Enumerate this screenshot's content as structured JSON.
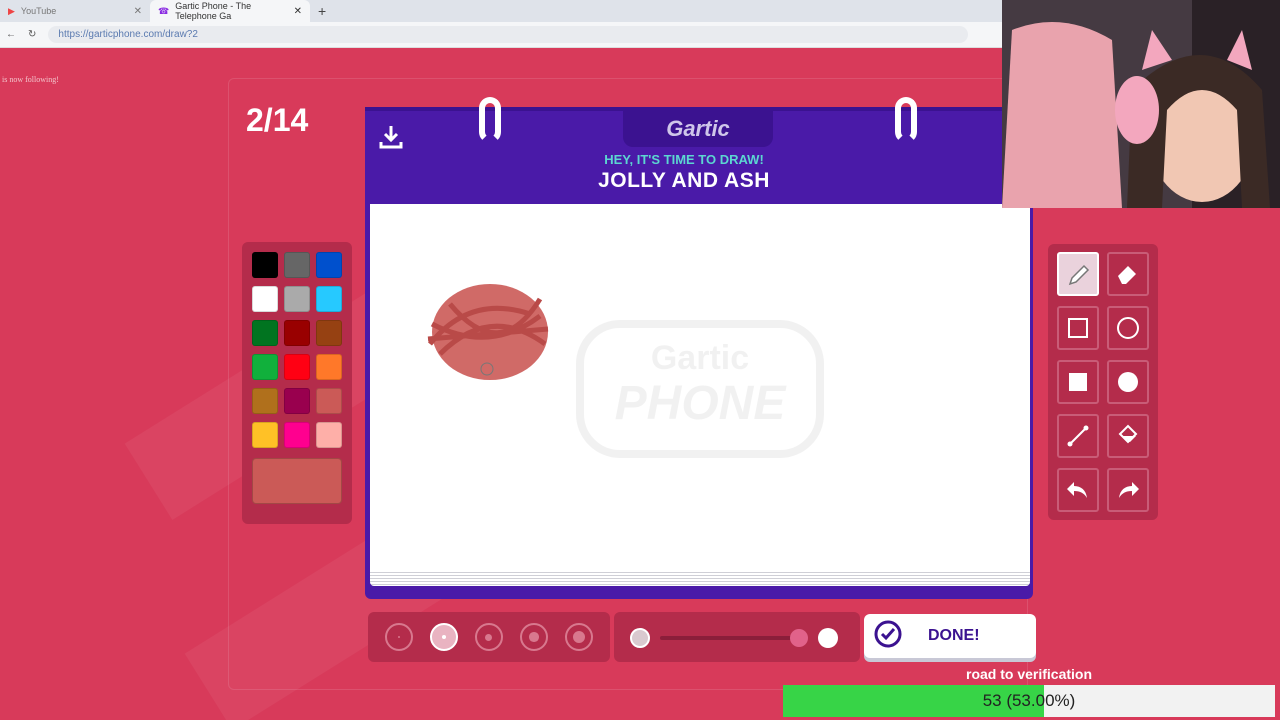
{
  "browser": {
    "tabs": [
      {
        "label": "YouTube",
        "active": false
      },
      {
        "label": "Gartic Phone - The Telephone Ga",
        "active": true
      }
    ],
    "new_tab_symbol": "+",
    "url": "https://garticphone.com/draw?2"
  },
  "chat_notice": "is now following!",
  "game": {
    "counter": "2/14",
    "logo": "Gartic",
    "prompt_label": "HEY, IT'S TIME TO DRAW!",
    "prompt": "JOLLY AND ASH",
    "watermark_top": "Gartic",
    "watermark_bottom": "PHONE",
    "palette": [
      "#000000",
      "#666666",
      "#0050cd",
      "#ffffff",
      "#aaaaaa",
      "#26c9ff",
      "#017420",
      "#990000",
      "#964112",
      "#11b03c",
      "#ff0013",
      "#ff7829",
      "#b0701c",
      "#99004e",
      "#cb5a57",
      "#ffc126",
      "#ff008f",
      "#feafa8"
    ],
    "current_color": "#cb5a57",
    "tools": [
      "pencil-icon",
      "eraser-icon",
      "rectangle-outline-icon",
      "circle-outline-icon",
      "rectangle-fill-icon",
      "circle-fill-icon",
      "line-icon",
      "bucket-icon",
      "undo-icon",
      "redo-icon"
    ],
    "active_tool": "pencil-icon",
    "brush_sizes": 5,
    "active_brush_size": 2,
    "done_label": "DONE!"
  },
  "goal": {
    "title": "road to verification",
    "progress_text": "53 (53.00%)",
    "progress_percent": 53
  }
}
